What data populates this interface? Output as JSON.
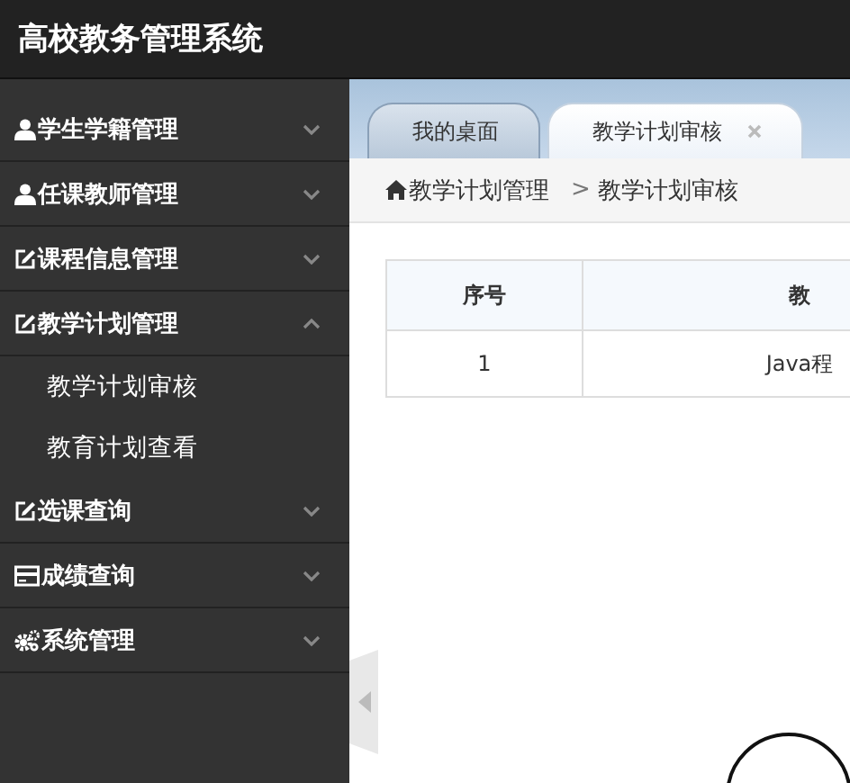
{
  "header": {
    "title": "高校教务管理系统"
  },
  "sidebar": {
    "menus": [
      {
        "kind": "user",
        "label": "学生学籍管理",
        "expanded": false
      },
      {
        "kind": "user",
        "label": "任课教师管理",
        "expanded": false
      },
      {
        "kind": "edit",
        "label": "课程信息管理",
        "expanded": false
      },
      {
        "kind": "edit",
        "label": "教学计划管理",
        "expanded": true,
        "children": [
          {
            "label": "教学计划审核"
          },
          {
            "label": "教育计划查看"
          }
        ]
      },
      {
        "kind": "edit",
        "label": "选课查询",
        "expanded": false
      },
      {
        "kind": "card",
        "label": "成绩查询",
        "expanded": false
      },
      {
        "kind": "gears",
        "label": "系统管理",
        "expanded": false
      }
    ]
  },
  "tabs": [
    {
      "label": "我的桌面",
      "selected": false,
      "closable": false
    },
    {
      "label": "教学计划审核",
      "selected": true,
      "closable": true
    }
  ],
  "breadcrumb": {
    "separator": ">",
    "items": [
      {
        "label": "教学计划管理"
      },
      {
        "label": "教学计划审核"
      }
    ]
  },
  "table": {
    "columns": [
      "序号",
      "教"
    ],
    "rows": [
      [
        "1",
        "Java程"
      ]
    ]
  }
}
